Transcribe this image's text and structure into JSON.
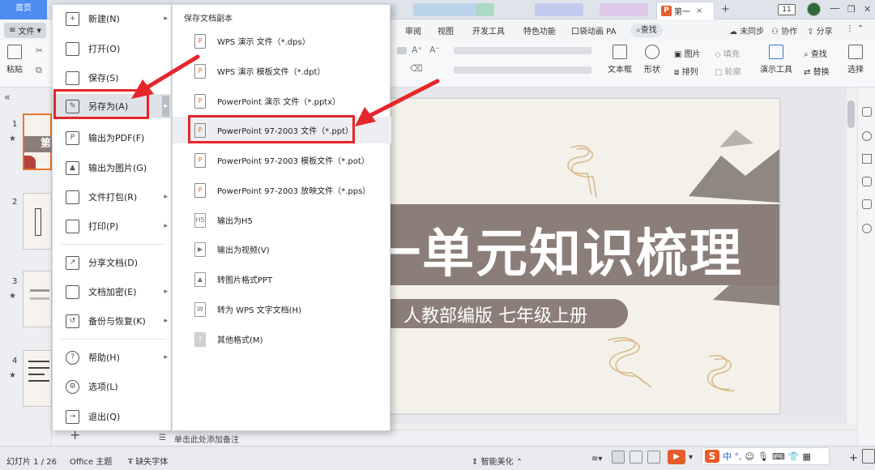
{
  "titlebar": {
    "home_tab": "首页",
    "doc_tab": "第一",
    "doc_badge": "P",
    "new_tab": "+",
    "page_count": "11",
    "min_btn": "—",
    "max_btn": "❐",
    "close_btn": "✕"
  },
  "ribbon": {
    "file_label": "文件",
    "tabs": [
      "审阅",
      "视图",
      "开发工具",
      "特色功能",
      "口袋动画 PA"
    ],
    "search_tab": "查找",
    "right": {
      "sync": "未同步",
      "collab": "协作",
      "share": "分享"
    }
  },
  "toolbar": {
    "paste": "粘贴",
    "textbox": "文本框",
    "shape": "形状",
    "arrange": "排列",
    "picture": "图片",
    "fill": "填充",
    "outline": "轮廓",
    "present_tools": "演示工具",
    "find": "查找",
    "replace": "替换",
    "select": "选择"
  },
  "thumbnails": {
    "collapse": "«",
    "slide_numbers": [
      "1",
      "2",
      "3",
      "4"
    ],
    "thumb1_text": "第"
  },
  "file_menu": {
    "items": [
      {
        "label": "新建(N)",
        "icon": "new-doc-icon",
        "arrow": true
      },
      {
        "label": "打开(O)",
        "icon": "folder-open-icon",
        "arrow": false
      },
      {
        "label": "保存(S)",
        "icon": "save-icon",
        "arrow": false
      },
      {
        "label": "另存为(A)",
        "icon": "save-as-icon",
        "arrow": true
      },
      {
        "label": "输出为PDF(F)",
        "icon": "pdf-icon",
        "arrow": false
      },
      {
        "label": "输出为图片(G)",
        "icon": "image-export-icon",
        "arrow": false
      },
      {
        "label": "文件打包(R)",
        "icon": "package-icon",
        "arrow": true
      },
      {
        "label": "打印(P)",
        "icon": "print-icon",
        "arrow": true
      },
      {
        "label": "分享文档(D)",
        "icon": "share-icon",
        "arrow": false
      },
      {
        "label": "文档加密(E)",
        "icon": "encrypt-icon",
        "arrow": true
      },
      {
        "label": "备份与恢复(K)",
        "icon": "backup-icon",
        "arrow": true
      },
      {
        "label": "帮助(H)",
        "icon": "help-icon",
        "arrow": true
      },
      {
        "label": "选项(L)",
        "icon": "options-gear-icon",
        "arrow": false
      },
      {
        "label": "退出(Q)",
        "icon": "exit-icon",
        "arrow": false
      }
    ]
  },
  "submenu": {
    "header": "保存文档副本",
    "items": [
      "WPS 演示 文件（*.dps）",
      "WPS 演示 模板文件（*.dpt）",
      "PowerPoint 演示 文件（*.pptx）",
      "PowerPoint 97-2003 文件（*.ppt）",
      "PowerPoint 97-2003 模板文件（*.pot）",
      "PowerPoint 97-2003 放映文件（*.pps）",
      "输出为H5",
      "输出为视频(V)",
      "转图片格式PPT",
      "转为 WPS 文字文档(H)",
      "其他格式(M)"
    ]
  },
  "slide": {
    "title": "一单元知识梳理",
    "subtitle": "人教部编版 七年级上册"
  },
  "notes": {
    "placeholder": "单击此处添加备注",
    "add": "+"
  },
  "statusbar": {
    "slide_counter": "幻灯片 1 / 26",
    "theme": "Office 主题",
    "missing_font": "缺失字体",
    "beautify": "智能美化",
    "ime_chars": "中 °,"
  },
  "colors": {
    "accent": "#4d8bf1",
    "annotation_red": "#e5262b",
    "slide_band": "#8b7e78"
  }
}
